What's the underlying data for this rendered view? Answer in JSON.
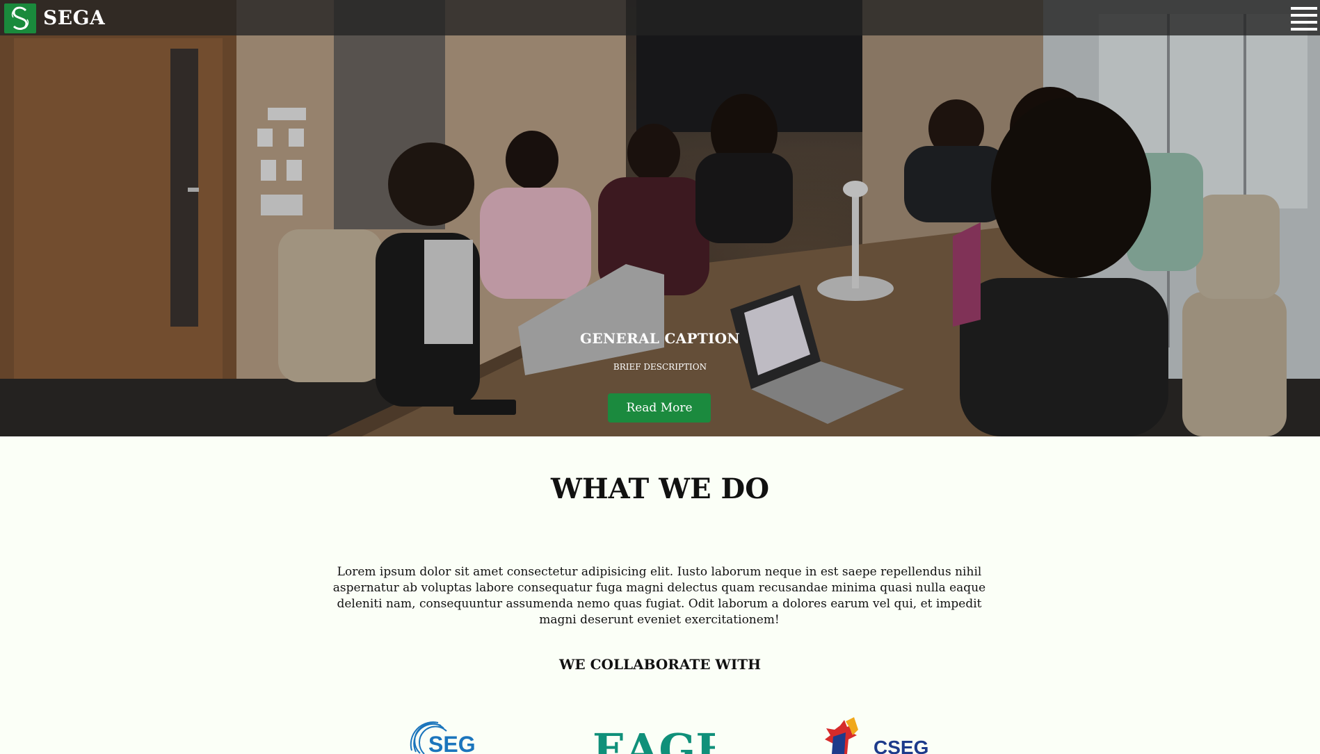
{
  "navbar": {
    "brand": "SEGA",
    "logo_icon": "sega-logo-icon",
    "menu_icon": "hamburger-menu-icon"
  },
  "hero": {
    "caption_title": "GENERAL CAPTION",
    "caption_description": "BRIEF DESCRIPTION",
    "button_label": "Read More"
  },
  "what_we_do": {
    "title": "WHAT WE DO",
    "body": "Lorem ipsum dolor sit amet consectetur adipisicing elit. Iusto laborum neque in est saepe repellendus nihil aspernatur ab voluptas labore consequatur fuga magni delectus quam recusandae minima quasi nulla eaque deleniti nam, consequuntur assumenda nemo quas fugiat. Odit laborum a dolores earum vel qui, et impedit magni deserunt eveniet exercitationem!"
  },
  "collaborate": {
    "title": "WE COLLABORATE WITH",
    "partners": [
      {
        "name": "SEG"
      },
      {
        "name": "EAGE"
      },
      {
        "name": "CSEG"
      }
    ]
  },
  "colors": {
    "brand_green": "#1b8a3e",
    "navbar_bg": "#232323",
    "page_bg": "#fbfff7",
    "seg_blue": "#1b75bc",
    "eage_teal": "#10907a",
    "cseg_navy": "#1d3b8b",
    "cseg_red": "#d62b2b",
    "cseg_gold": "#f0a81c"
  }
}
